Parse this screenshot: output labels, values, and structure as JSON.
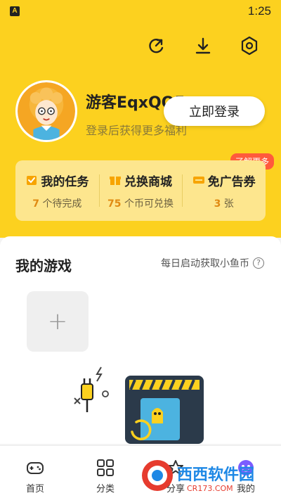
{
  "status_bar": {
    "time": "1:25",
    "app_icon_letter": "A"
  },
  "header": {
    "icons": [
      "refresh-icon",
      "download-icon",
      "settings-icon"
    ],
    "username": "游客EqxQQ5",
    "subtitle": "登录后获得更多福利",
    "login_label": "立即登录"
  },
  "stats": {
    "more_badge": "了解更多",
    "items": [
      {
        "title": "我的任务",
        "num": "7",
        "suffix": "个待完成",
        "icon": "task-icon"
      },
      {
        "title": "兑换商城",
        "num": "75",
        "suffix": "个币可兑换",
        "icon": "gift-icon"
      },
      {
        "title": "免广告券",
        "num": "3",
        "suffix": "张",
        "icon": "coupon-icon"
      }
    ]
  },
  "games": {
    "title": "我的游戏",
    "hint": "每日启动获取小鱼币",
    "add_label": "+"
  },
  "nav": {
    "items": [
      {
        "label": "首页",
        "icon": "gamepad-icon"
      },
      {
        "label": "分类",
        "icon": "grid-icon"
      },
      {
        "label": "分享",
        "icon": "share-icon"
      },
      {
        "label": "我的",
        "icon": "profile-icon"
      }
    ]
  },
  "watermark": {
    "brand": "西西软件园",
    "url": "CR173.COM"
  },
  "colors": {
    "brand_yellow": "#fcd11f",
    "card_yellow": "#fde68e",
    "badge_red": "#ff5a3c",
    "accent_orange": "#e08a12"
  }
}
